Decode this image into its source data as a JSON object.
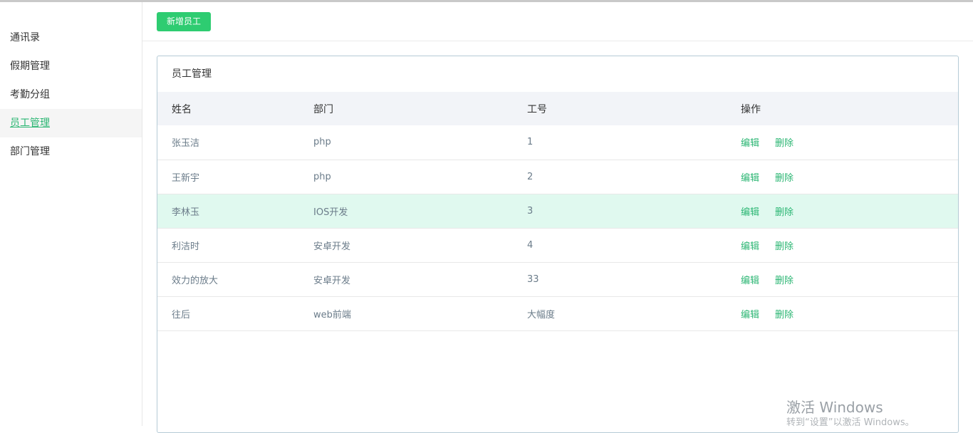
{
  "sidebar": {
    "items": [
      {
        "label": "通讯录"
      },
      {
        "label": "假期管理"
      },
      {
        "label": "考勤分组"
      },
      {
        "label": "员工管理"
      },
      {
        "label": "部门管理"
      }
    ]
  },
  "toolbar": {
    "add_label": "新增员工"
  },
  "panel": {
    "title": "员工管理",
    "columns": [
      "姓名",
      "部门",
      "工号",
      "操作"
    ],
    "rows": [
      {
        "name": "张玉洁",
        "dept": "php",
        "id": "1",
        "edit": "编辑",
        "delete": "删除"
      },
      {
        "name": "王新宇",
        "dept": "php",
        "id": "2",
        "edit": "编辑",
        "delete": "删除"
      },
      {
        "name": "李林玉",
        "dept": "IOS开发",
        "id": "3",
        "edit": "编辑",
        "delete": "删除"
      },
      {
        "name": "利洁时",
        "dept": "安卓开发",
        "id": "4",
        "edit": "编辑",
        "delete": "删除"
      },
      {
        "name": "效力的放大",
        "dept": "安卓开发",
        "id": "33",
        "edit": "编辑",
        "delete": "删除"
      },
      {
        "name": "往后",
        "dept": "web前端",
        "id": "大幅度",
        "edit": "编辑",
        "delete": "删除"
      }
    ]
  },
  "watermark": {
    "line1": "激活 Windows",
    "line2": "转到“设置”以激活 Windows。"
  },
  "colors": {
    "accent": "#2ecc71",
    "link": "#2bb673",
    "highlight_row": "#e0f9ef"
  }
}
